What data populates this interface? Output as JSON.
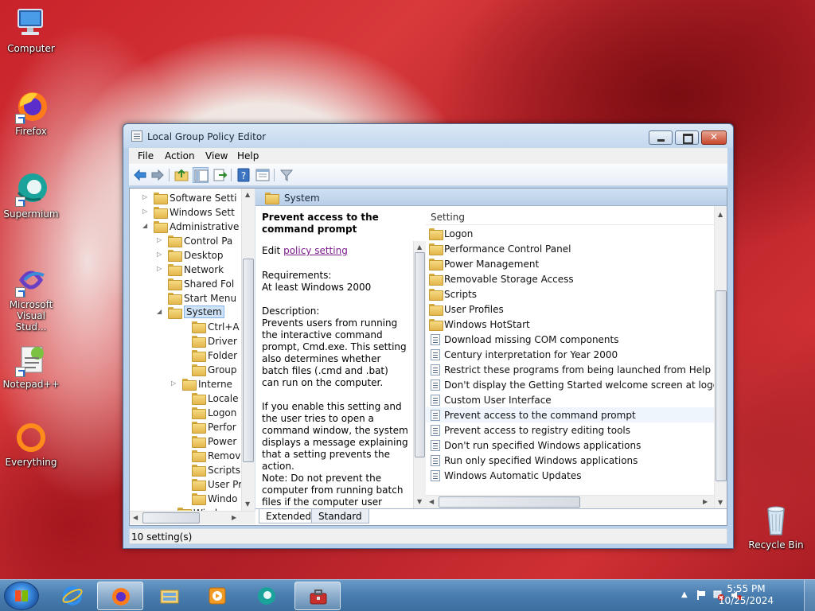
{
  "desktop": {
    "icons": [
      {
        "label": "Computer"
      },
      {
        "label": "Firefox"
      },
      {
        "label": "Supermium"
      },
      {
        "label": "Microsoft Visual Stud..."
      },
      {
        "label": "Notepad++"
      },
      {
        "label": "Everything"
      },
      {
        "label": "Recycle Bin"
      }
    ]
  },
  "window": {
    "title": "Local Group Policy Editor",
    "menu": [
      "File",
      "Action",
      "View",
      "Help"
    ],
    "tree": [
      {
        "label": "Software Setti",
        "expander": "▷"
      },
      {
        "label": "Windows Sett",
        "expander": "▷"
      },
      {
        "label": "Administrative",
        "expander": "◢"
      },
      {
        "label": "Control Pa",
        "expander": "▷"
      },
      {
        "label": "Desktop",
        "expander": "▷"
      },
      {
        "label": "Network",
        "expander": "▷"
      },
      {
        "label": "Shared Fol",
        "expander": ""
      },
      {
        "label": "Start Menu",
        "expander": ""
      },
      {
        "label": "System",
        "expander": "◢"
      },
      {
        "label": "Ctrl+A",
        "expander": ""
      },
      {
        "label": "Driver",
        "expander": ""
      },
      {
        "label": "Folder",
        "expander": ""
      },
      {
        "label": "Group",
        "expander": ""
      },
      {
        "label": "Interne",
        "expander": "▷"
      },
      {
        "label": "Locale",
        "expander": ""
      },
      {
        "label": "Logon",
        "expander": ""
      },
      {
        "label": "Perfor",
        "expander": ""
      },
      {
        "label": "Power",
        "expander": ""
      },
      {
        "label": "Remov",
        "expander": ""
      },
      {
        "label": "Scripts",
        "expander": ""
      },
      {
        "label": "User Pr",
        "expander": ""
      },
      {
        "label": "Windo",
        "expander": ""
      },
      {
        "label": "Windo",
        "expander": ""
      }
    ],
    "header_label": "System",
    "extended": {
      "title": "Prevent access to the command prompt",
      "edit_prefix": "Edit",
      "edit_link": "policy setting",
      "requirements_label": "Requirements:",
      "requirements_value": "At least Windows 2000",
      "description_label": "Description:",
      "description": "Prevents users from running the interactive command prompt, Cmd.exe. This setting also determines whether batch files (.cmd and .bat) can run on the computer.",
      "para2": "If you enable this setting and the user tries to open a command window, the system displays a message explaining that a setting prevents the action.",
      "note": "Note: Do not prevent the computer from running batch files if the computer user logon"
    },
    "list_header": "Setting",
    "list": [
      {
        "label": "Logon",
        "kind": "folder"
      },
      {
        "label": "Performance Control Panel",
        "kind": "folder"
      },
      {
        "label": "Power Management",
        "kind": "folder"
      },
      {
        "label": "Removable Storage Access",
        "kind": "folder"
      },
      {
        "label": "Scripts",
        "kind": "folder"
      },
      {
        "label": "User Profiles",
        "kind": "folder"
      },
      {
        "label": "Windows HotStart",
        "kind": "folder"
      },
      {
        "label": "Download missing COM components",
        "kind": "setting"
      },
      {
        "label": "Century interpretation for Year 2000",
        "kind": "setting"
      },
      {
        "label": "Restrict these programs from being launched from Help",
        "kind": "setting"
      },
      {
        "label": "Don't display the Getting Started welcome screen at logon",
        "kind": "setting"
      },
      {
        "label": "Custom User Interface",
        "kind": "setting"
      },
      {
        "label": "Prevent access to the command prompt",
        "kind": "setting",
        "hover": true
      },
      {
        "label": "Prevent access to registry editing tools",
        "kind": "setting"
      },
      {
        "label": "Don't run specified Windows applications",
        "kind": "setting"
      },
      {
        "label": "Run only specified Windows applications",
        "kind": "setting"
      },
      {
        "label": "Windows Automatic Updates",
        "kind": "setting"
      }
    ],
    "tabs": {
      "extended": "Extended",
      "standard": "Standard"
    },
    "status": "10 setting(s)"
  },
  "taskbar": {
    "time": "5:55 PM",
    "date": "10/25/2024",
    "apps": [
      "internet-explorer-icon",
      "firefox-icon",
      "file-explorer-icon",
      "media-player-icon",
      "supermium-icon",
      "group-policy-icon"
    ]
  },
  "colors": {
    "accent": "#3c6e9f",
    "selection": "#cfe3f8"
  }
}
